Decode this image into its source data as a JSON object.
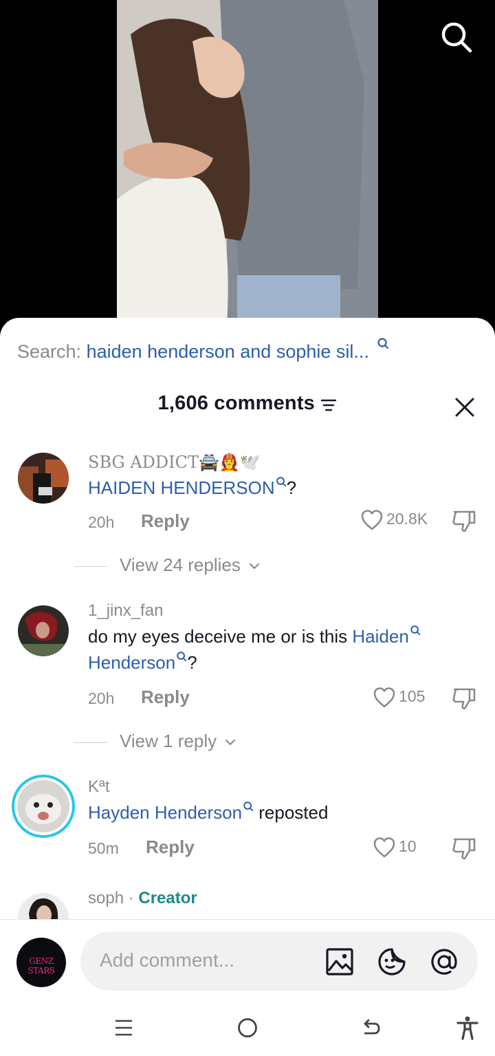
{
  "search": {
    "label": "Search:",
    "query": "haiden henderson and sophie sil..."
  },
  "header": {
    "comment_count": "1,606 comments"
  },
  "comments": [
    {
      "username": "SBG ADDICT🚔👩‍🚒🕊️",
      "text_link": "HAIDEN HENDERSON",
      "text_after": "?",
      "time": "20h",
      "reply_label": "Reply",
      "likes": "20.8K",
      "view_replies": "View 24 replies"
    },
    {
      "username": "1_jinx_fan",
      "text_before": "do my eyes deceive me or is this ",
      "text_link": "Haiden",
      "text_link2": "Henderson",
      "text_after": "?",
      "time": "20h",
      "reply_label": "Reply",
      "likes": "105",
      "view_replies": "View 1 reply"
    },
    {
      "username": "Kªt",
      "text_link": "Hayden Henderson",
      "text_after": " reposted",
      "time": "50m",
      "reply_label": "Reply",
      "likes": "10"
    },
    {
      "username": "soph",
      "separator": " · ",
      "badge": "Creator"
    }
  ],
  "input": {
    "placeholder": "Add comment...",
    "avatar_text": "GENZ STARS"
  },
  "colors": {
    "link": "#2e5ea8",
    "muted": "#8a8a8a",
    "text": "#161823",
    "creator": "#1e8a8a",
    "story_ring": "#29c7e6"
  }
}
